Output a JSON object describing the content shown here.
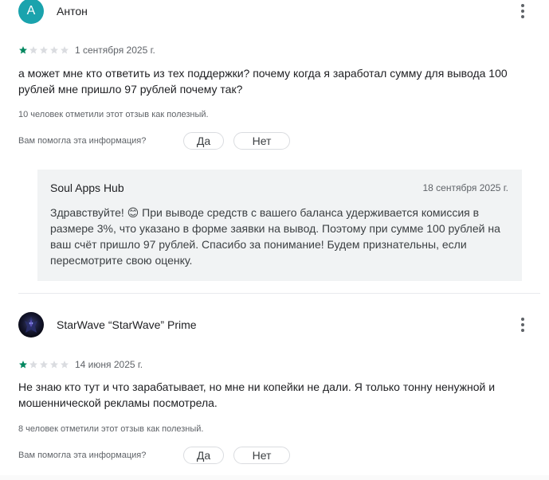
{
  "reviews": [
    {
      "author": "Антон",
      "avatar_letter": "А",
      "avatar_color": "#1aa3ad",
      "rating": 1,
      "rating_max": 5,
      "date": "1 сентября 2025 г.",
      "text": "а может мне кто ответить из тех поддержки? почему когда я заработал сумму для вывода 100 рублей мне пришло 97 рублей почему так?",
      "helpful_count": "10 человек отметили этот отзыв как полезный.",
      "helpful_question": "Вам помогла эта информация?",
      "yes_label": "Да",
      "no_label": "Нет",
      "more_icon": "more-vert-icon",
      "developer_reply": {
        "name": "Soul Apps Hub",
        "date": "18 сентября 2025 г.",
        "text": "Здравствуйте! 😊 При выводе средств с вашего баланса удерживается комиссия в размере 3%, что указано в форме заявки на вывод. Поэтому при сумме 100 рублей на ваш счёт пришло 97 рублей. Спасибо за понимание! Будем признательны, если пересмотрите свою оценку."
      }
    },
    {
      "author": "StarWave “StarWave” Prime",
      "avatar_icon": "profile-image",
      "rating": 1,
      "rating_max": 5,
      "date": "14 июня 2025 г.",
      "text": "Не знаю кто тут и что зарабатывает, но мне ни копейки не дали. Я только тонну ненужной и мошеннической рекламы посмотрела.",
      "helpful_count": "8 человек отметили этот отзыв как полезный.",
      "helpful_question": "Вам помогла эта информация?",
      "yes_label": "Да",
      "no_label": "Нет",
      "more_icon": "more-vert-icon"
    }
  ],
  "colors": {
    "star_filled": "#01875f",
    "star_empty": "#dadce0",
    "reply_background": "#f1f3f4"
  }
}
